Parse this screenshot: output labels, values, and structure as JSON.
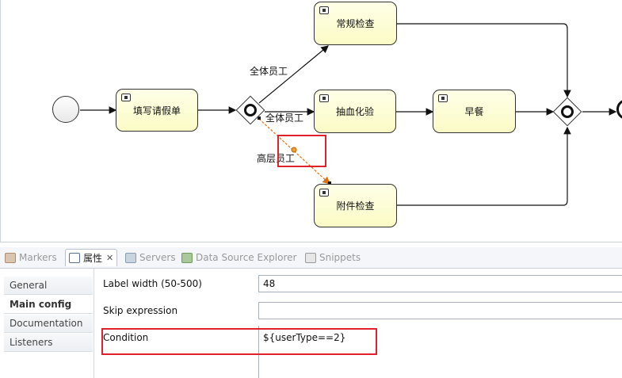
{
  "diagram": {
    "tasks": {
      "fill_form": "填写请假单",
      "routine_check": "常规检查",
      "blood_test": "抽血化验",
      "breakfast": "早餐",
      "extra_check": "附件检查"
    },
    "flows": {
      "all_staff_upper": "全体员工",
      "all_staff_middle": "全体员工",
      "senior_staff": "高层员工"
    }
  },
  "tabs": [
    {
      "label": "Markers",
      "icon": "markers-icon"
    },
    {
      "label": "属性",
      "icon": "properties-icon",
      "active": true
    },
    {
      "label": "Servers",
      "icon": "servers-icon"
    },
    {
      "label": "Data Source Explorer",
      "icon": "data-source-icon"
    },
    {
      "label": "Snippets",
      "icon": "snippets-icon"
    }
  ],
  "sidebar": {
    "items": [
      {
        "label": "General"
      },
      {
        "label": "Main config",
        "active": true
      },
      {
        "label": "Documentation"
      },
      {
        "label": "Listeners"
      }
    ]
  },
  "properties": {
    "label_width": {
      "label": "Label width (50-500)",
      "value": "48"
    },
    "skip_expression": {
      "label": "Skip expression",
      "value": ""
    },
    "condition": {
      "label": "Condition",
      "value": "${userType==2}"
    }
  },
  "colors": {
    "highlight": "#e0202a",
    "selected_flow": "#f08c00",
    "task_fill": "#fbfbc6"
  }
}
